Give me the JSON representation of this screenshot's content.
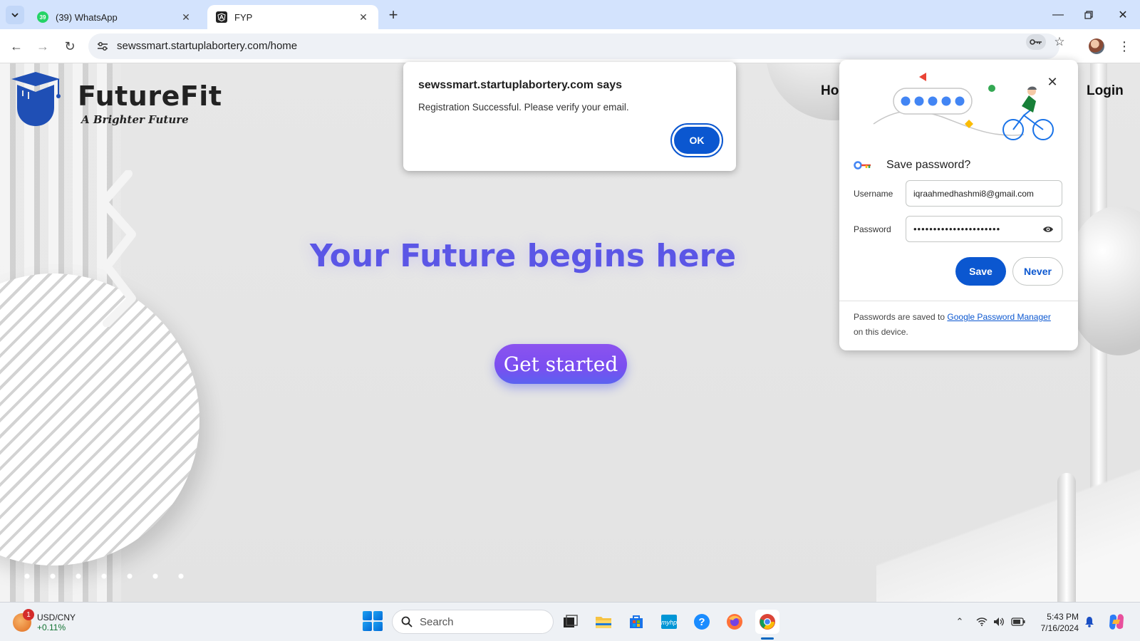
{
  "browser": {
    "tabs": [
      {
        "title": "(39) WhatsApp",
        "badge": "39",
        "active": false
      },
      {
        "title": "FYP",
        "active": true
      }
    ],
    "url": "sewssmart.startuplabortery.com/home"
  },
  "page": {
    "logo": {
      "name": "FutureFit",
      "tagline": "A Brighter Future"
    },
    "nav": {
      "home": "Ho",
      "login": "Login"
    },
    "hero_title": "Your Future begins here",
    "cta_label": "Get started"
  },
  "alert": {
    "title": "sewssmart.startuplabortery.com says",
    "message": "Registration Successful. Please verify your email.",
    "ok_label": "OK"
  },
  "password_bubble": {
    "title": "Save password?",
    "username_label": "Username",
    "username_value": "iqraahmedhashmi8@gmail.com",
    "password_label": "Password",
    "password_mask": "••••••••••••••••••••••",
    "save_label": "Save",
    "never_label": "Never",
    "footer_prefix": "Passwords are saved to",
    "footer_link": "Google Password Manager",
    "footer_suffix": "on this device."
  },
  "taskbar": {
    "widget": {
      "badge": "1",
      "ticker": "USD/CNY",
      "change": "+0.11%"
    },
    "search_placeholder": "Search",
    "clock": {
      "time": "5:43 PM",
      "date": "7/16/2024"
    }
  },
  "colors": {
    "accent": "#0b57d0",
    "hero_text": "#5b56e6",
    "cta_gradient": "#8b53ef",
    "tabstrip": "#d3e3fd",
    "logo_blue": "#1f4fb5"
  }
}
